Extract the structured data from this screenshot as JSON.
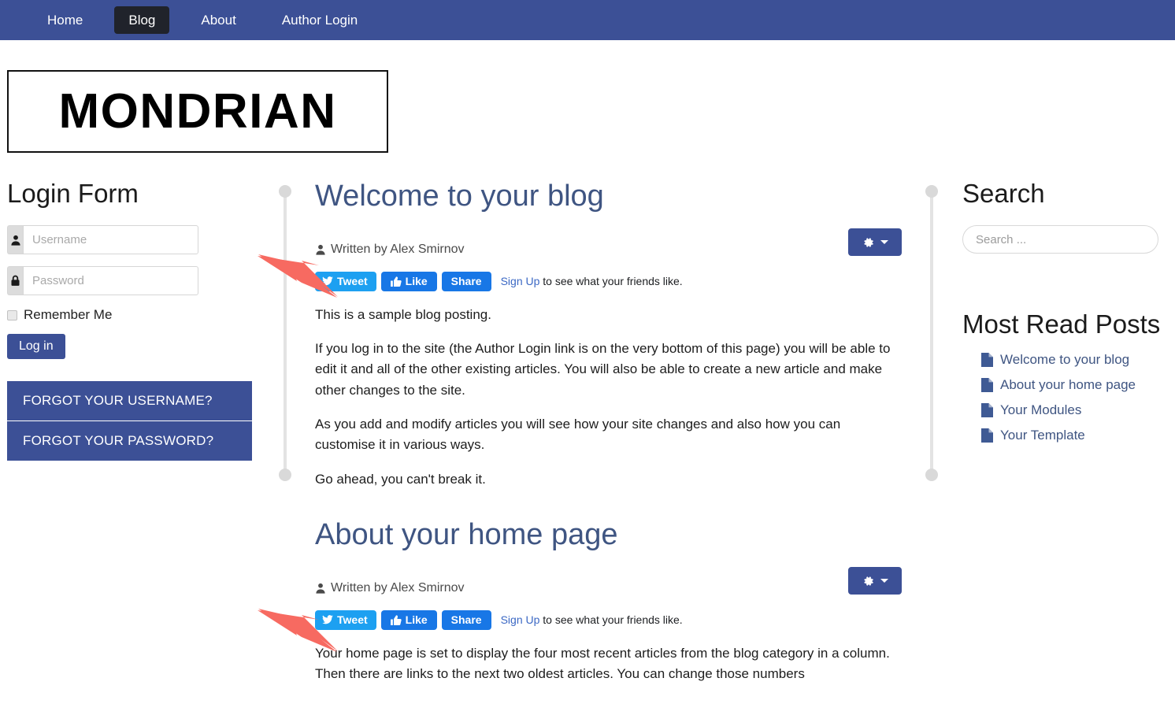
{
  "nav": {
    "items": [
      {
        "label": "Home",
        "active": false
      },
      {
        "label": "Blog",
        "active": true
      },
      {
        "label": "About",
        "active": false
      },
      {
        "label": "Author Login",
        "active": false
      }
    ]
  },
  "logo": {
    "text": "MONDRIAN"
  },
  "colors": {
    "brand_blue": "#3c5096",
    "nav_active": "#20232b",
    "heading_blue": "#3f5582",
    "twitter_blue": "#1da0f1",
    "facebook_blue": "#1877e6",
    "link_blue": "#3b68c4",
    "arrow_red": "#f76a61"
  },
  "login_form": {
    "title": "Login Form",
    "username": {
      "value": "",
      "placeholder": "Username",
      "icon": "user-icon"
    },
    "password": {
      "value": "",
      "placeholder": "Password",
      "icon": "lock-icon"
    },
    "remember_label": "Remember Me",
    "remember_checked": false,
    "login_button": "Log in",
    "forgot_username": "FORGOT YOUR USERNAME?",
    "forgot_password": "FORGOT YOUR PASSWORD?"
  },
  "articles": [
    {
      "title": "Welcome to your blog",
      "byline": "Written by Alex Smirnov",
      "social": {
        "tweet": "Tweet",
        "like": "Like",
        "share": "Share",
        "signup_link": "Sign Up",
        "signup_rest": " to see what your friends like."
      },
      "paragraphs": [
        "This is a sample blog posting.",
        "If you log in to the site (the Author Login link is on the very bottom of this page) you will be able to edit it and all of the other existing articles. You will also be able to create a new article and make other changes to the site.",
        "As you add and modify articles you will see how your site changes and also how you can customise it in various ways.",
        "Go ahead, you can't break it."
      ]
    },
    {
      "title": "About your home page",
      "byline": "Written by Alex Smirnov",
      "social": {
        "tweet": "Tweet",
        "like": "Like",
        "share": "Share",
        "signup_link": "Sign Up",
        "signup_rest": " to see what your friends like."
      },
      "paragraphs": [
        "Your home page is set to display the four most recent articles from the blog category in a column. Then there are links to the next two oldest articles. You can change those numbers"
      ]
    }
  ],
  "search": {
    "title": "Search",
    "value": "",
    "placeholder": "Search ..."
  },
  "most_read": {
    "title": "Most Read Posts",
    "items": [
      {
        "label": "Welcome to your blog",
        "icon": "document-icon"
      },
      {
        "label": "About your home page",
        "icon": "document-icon"
      },
      {
        "label": "Your Modules",
        "icon": "document-icon"
      },
      {
        "label": "Your Template",
        "icon": "document-icon"
      }
    ]
  }
}
